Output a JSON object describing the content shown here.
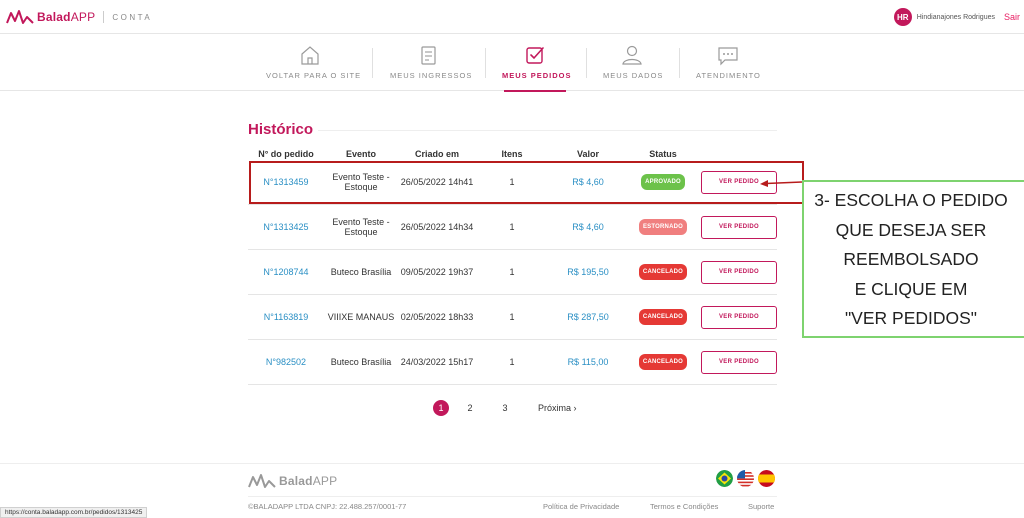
{
  "header": {
    "brand_bold": "Balad",
    "brand_light": "APP",
    "brand_suffix": "CONTA",
    "avatar_initials": "HR",
    "user_name": "Hindianajones Rodrigues",
    "logout_label": "Sair"
  },
  "nav": {
    "items": [
      {
        "label": "VOLTAR PARA O SITE",
        "icon": "home-icon"
      },
      {
        "label": "MEUS INGRESSOS",
        "icon": "ticket-icon"
      },
      {
        "label": "MEUS PEDIDOS",
        "icon": "checkbox-icon",
        "active": true
      },
      {
        "label": "MEUS DADOS",
        "icon": "user-icon"
      },
      {
        "label": "ATENDIMENTO",
        "icon": "chat-icon"
      }
    ]
  },
  "history": {
    "title": "Histórico",
    "columns": [
      "N° do pedido",
      "Evento",
      "Criado em",
      "Itens",
      "Valor",
      "Status"
    ],
    "rows": [
      {
        "order": "N°1313459",
        "event_l1": "Evento Teste -",
        "event_l2": "Estoque",
        "created": "26/05/2022 14h41",
        "items": "1",
        "value": "R$ 4,60",
        "status": "APROVADO",
        "button": "VER PEDIDO"
      },
      {
        "order": "N°1313425",
        "event_l1": "Evento Teste -",
        "event_l2": "Estoque",
        "created": "26/05/2022 14h34",
        "items": "1",
        "value": "R$ 4,60",
        "status": "ESTORNADO",
        "button": "VER PEDIDO"
      },
      {
        "order": "N°1208744",
        "event_l1": "Buteco Brasília",
        "event_l2": "",
        "created": "09/05/2022 19h37",
        "items": "1",
        "value": "R$ 195,50",
        "status": "CANCELADO",
        "button": "VER PEDIDO"
      },
      {
        "order": "N°1163819",
        "event_l1": "VIIIXE MANAUS",
        "event_l2": "",
        "created": "02/05/2022 18h33",
        "items": "1",
        "value": "R$ 287,50",
        "status": "CANCELADO",
        "button": "VER PEDIDO"
      },
      {
        "order": "N°982502",
        "event_l1": "Buteco Brasília",
        "event_l2": "",
        "created": "24/03/2022 15h17",
        "items": "1",
        "value": "R$ 115,00",
        "status": "CANCELADO",
        "button": "VER PEDIDO"
      }
    ]
  },
  "pagination": {
    "pages": [
      "1",
      "2",
      "3"
    ],
    "current": "1",
    "next_label": "Próxima ›"
  },
  "annotation": {
    "lines": [
      "3- ESCOLHA O PEDIDO",
      "QUE DESEJA SER",
      "REEMBOLSADO",
      "E CLIQUE EM",
      "\"VER PEDIDOS\""
    ]
  },
  "footer": {
    "brand_bold": "Balad",
    "brand_light": "APP",
    "copyright": "©BALADAPP LTDA CNPJ: 22.488.257/0001-77",
    "links": [
      "Política de Privacidade",
      "Termos e Condições",
      "Suporte"
    ]
  },
  "status_bar": {
    "url": "https://conta.baladapp.com.br/pedidos/1313425"
  },
  "colors": {
    "brand": "#c2185b",
    "link": "#2a8fc4",
    "approved": "#6cc24a",
    "refunded": "#f07f7f",
    "cancelled": "#e53935",
    "highlight": "#b71c1c",
    "annotation_border": "#7ed36f"
  }
}
